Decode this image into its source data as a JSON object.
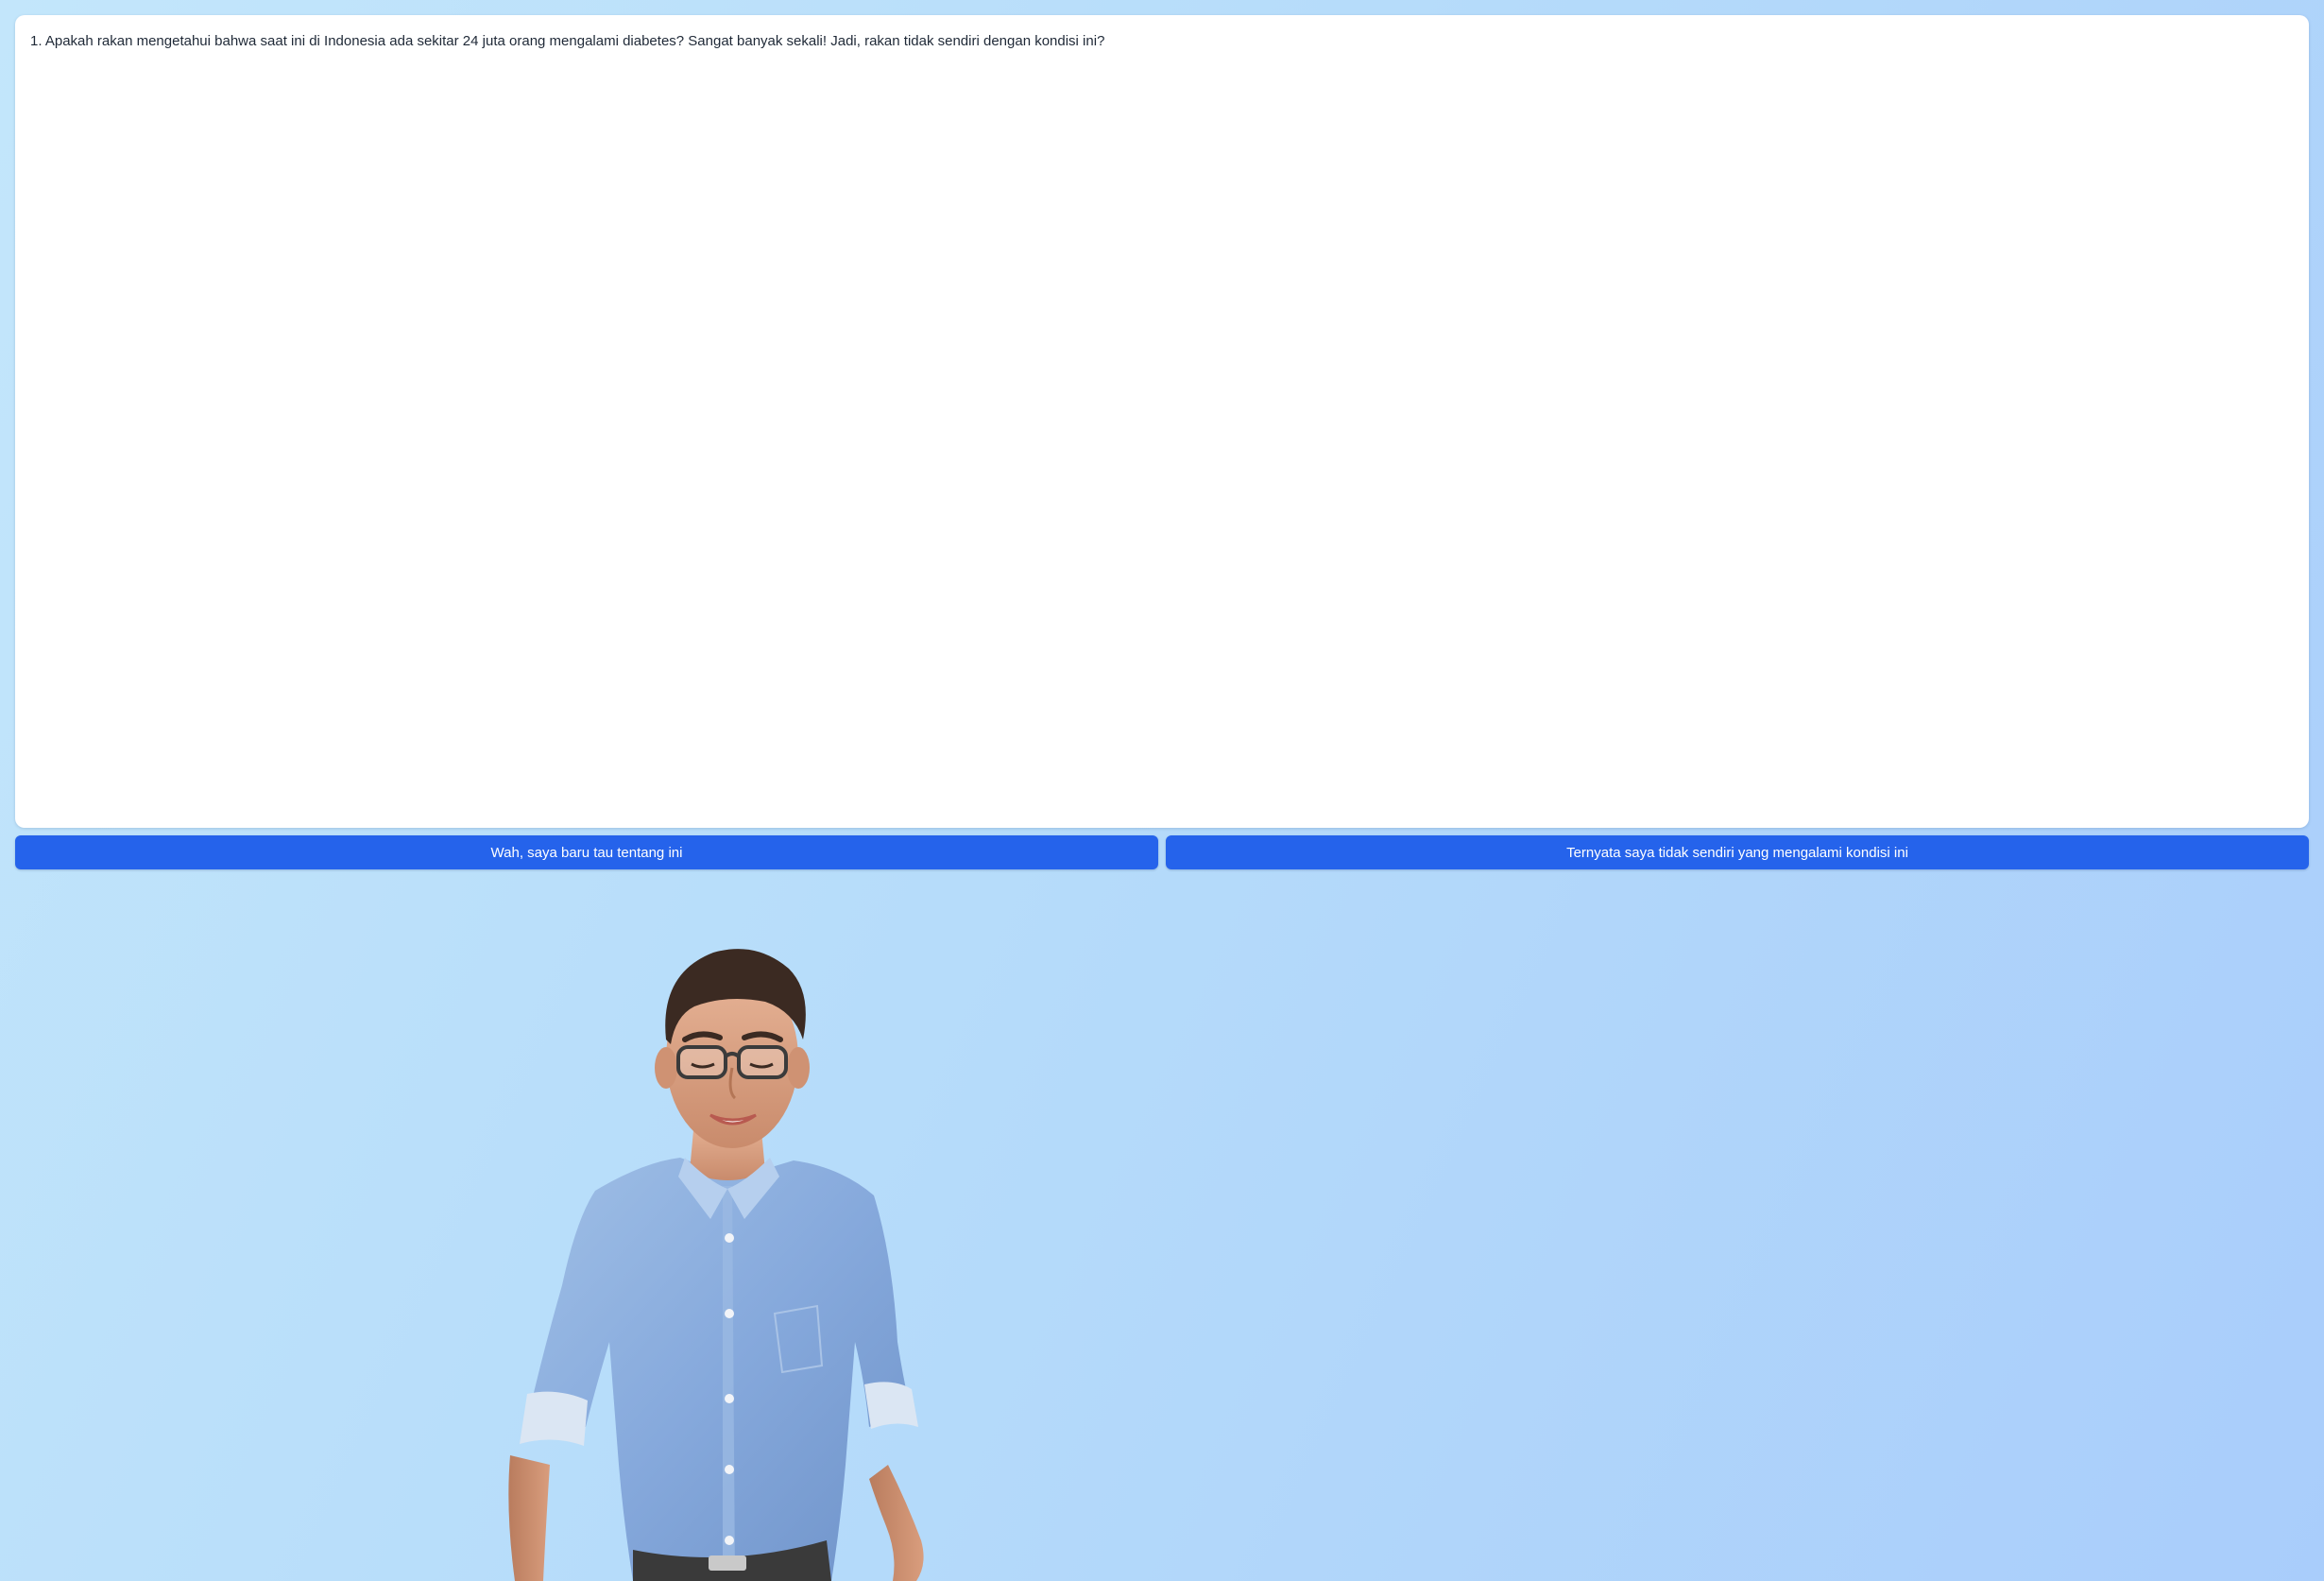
{
  "colors": {
    "accent": "#2563eb",
    "card_background": "#ffffff",
    "text": "#1f2937"
  },
  "dialog": {
    "text": "1. Apakah rakan mengetahui bahwa saat ini di Indonesia ada sekitar 24 juta orang mengalami diabetes? Sangat banyak sekali! Jadi, rakan tidak sendiri dengan kondisi ini?"
  },
  "choices": [
    {
      "label": "Wah, saya baru tau tentang ini"
    },
    {
      "label": "Ternyata saya tidak sendiri yang mengalami kondisi ini"
    }
  ],
  "avatar": {
    "icon": "avatar-character-icon"
  }
}
